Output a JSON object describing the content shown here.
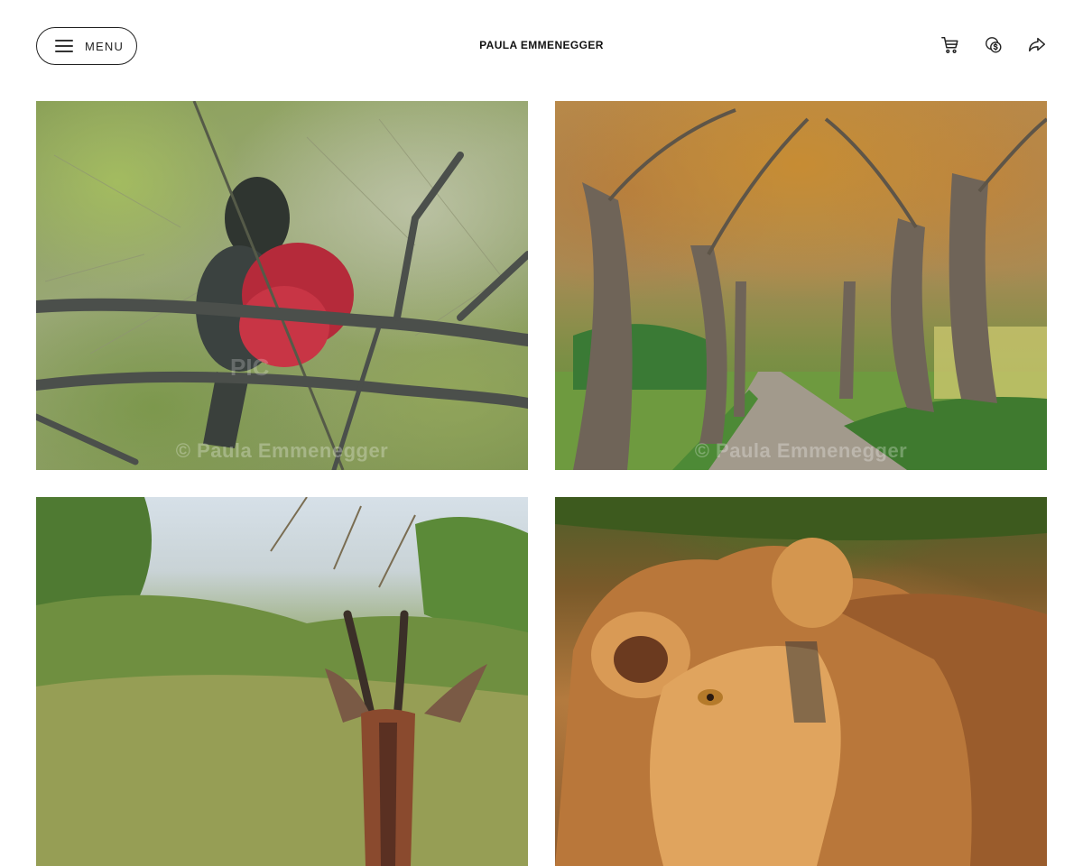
{
  "header": {
    "menu_label": "MENU",
    "site_title": "PAULA EMMENEGGER",
    "icons": [
      "cart-icon",
      "currency-icon",
      "share-icon"
    ]
  },
  "gallery": {
    "watermark": "© Paula Emmenegger",
    "pic_mark": "PIC",
    "tiles": [
      {
        "subject": "bird"
      },
      {
        "subject": "tree-avenue"
      },
      {
        "subject": "antelope"
      },
      {
        "subject": "lion"
      }
    ]
  },
  "colors": {
    "text": "#111111",
    "border": "#222222",
    "background": "#ffffff"
  }
}
